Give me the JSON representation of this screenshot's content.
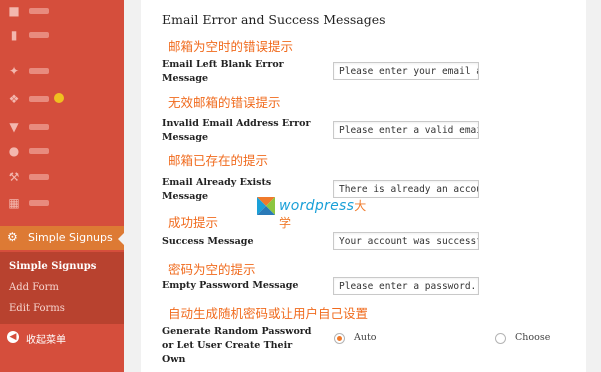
{
  "sidebar": {
    "active_item": "Simple Signups",
    "submenu": [
      "Simple Signups",
      "Add Form",
      "Edit Forms"
    ],
    "collapse_label": "收起菜单"
  },
  "form": {
    "section_title": "Email Error and Success Messages",
    "rows": [
      {
        "annotation": "邮箱为空时的错误提示",
        "label": "Email Left Blank Error Message",
        "value": "Please enter your email a"
      },
      {
        "annotation": "无效邮箱的错误提示",
        "label": "Invalid Email Address Error Message",
        "value": "Please enter a valid emai"
      },
      {
        "annotation": "邮箱已存在的提示",
        "label": "Email Already Exists Message",
        "value": "There is already an accou"
      },
      {
        "annotation": "成功提示",
        "label": "Success Message",
        "value": "Your account was successf"
      },
      {
        "annotation": "密码为空的提示",
        "label": "Empty Password Message",
        "value": "Please enter a password."
      }
    ],
    "password_option": {
      "annotation": "自动生成随机密码或让用户自己设置",
      "label": "Generate Random Password or Let User Create Their Own",
      "choices": [
        "Auto",
        "Choose"
      ],
      "selected": "Auto"
    }
  },
  "watermark": {
    "text": "wordpress",
    "suffix": "大学"
  },
  "colors": {
    "sidebar": "#d54e3c",
    "active": "#dd7a34",
    "annotation": "#f06b1e",
    "watermark": "#1aa0d8"
  }
}
